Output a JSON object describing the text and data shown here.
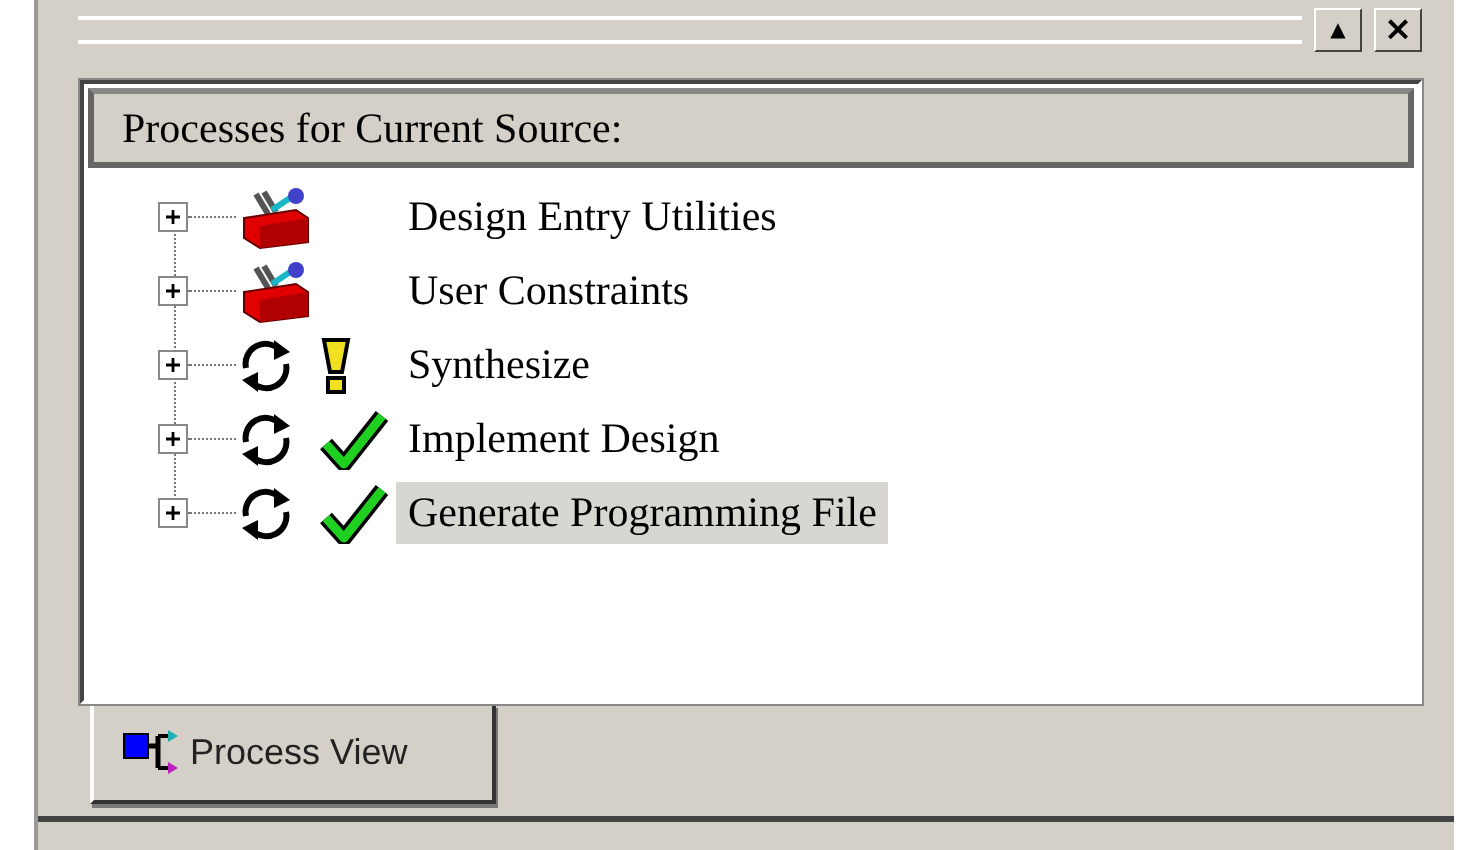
{
  "window": {
    "buttons": [
      {
        "kind": "up",
        "label": "▲"
      },
      {
        "kind": "close",
        "label": "×"
      }
    ]
  },
  "panel": {
    "header": "Processes for Current Source:"
  },
  "tree": [
    {
      "label": "Design Entry Utilities",
      "kind": "toolbox",
      "warning": false,
      "completed": false,
      "expanded": false,
      "selected": false
    },
    {
      "label": "User Constraints",
      "kind": "toolbox",
      "warning": false,
      "completed": false,
      "expanded": false,
      "selected": false
    },
    {
      "label": "Synthesize",
      "kind": "process",
      "warning": true,
      "completed": false,
      "expanded": false,
      "selected": false
    },
    {
      "label": "Implement Design",
      "kind": "process",
      "warning": false,
      "completed": true,
      "expanded": false,
      "selected": false
    },
    {
      "label": "Generate Programming File",
      "kind": "process",
      "warning": false,
      "completed": true,
      "expanded": false,
      "selected": true
    }
  ],
  "tabs": [
    {
      "label": "Process View",
      "selected": true
    }
  ]
}
